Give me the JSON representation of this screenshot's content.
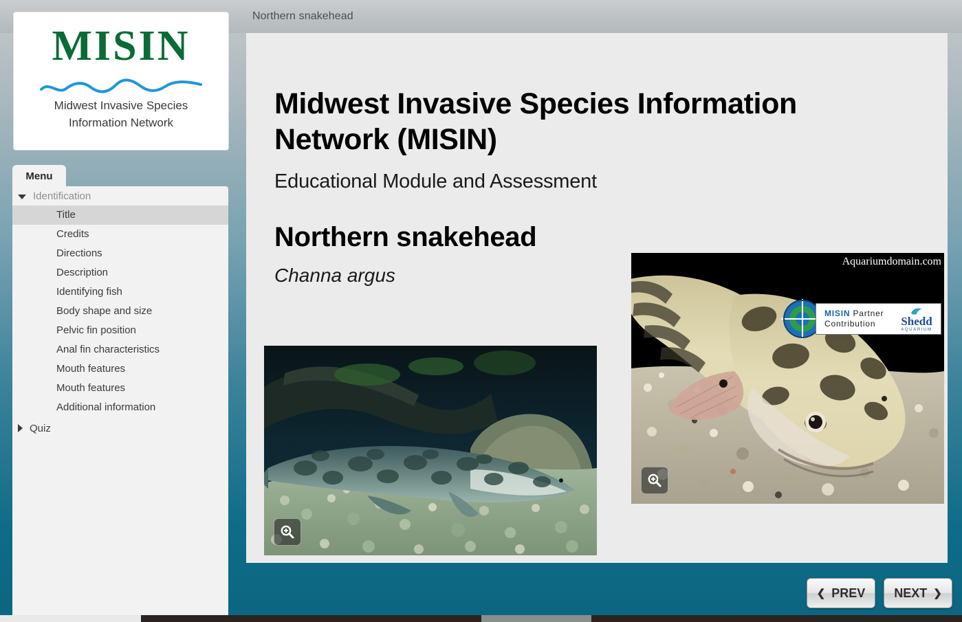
{
  "topbar": {
    "title": "Northern snakehead"
  },
  "logo": {
    "wordmark": "MISIN",
    "subtitle_line1": "Midwest Invasive Species",
    "subtitle_line2": "Information Network",
    "wave_color": "#2196d9",
    "wordmark_color": "#0a6b37"
  },
  "sidebar": {
    "tab_label": "Menu",
    "groups": [
      {
        "label": "Identification",
        "expanded": true,
        "icon": "chevron-down-icon",
        "items": [
          {
            "label": "Title",
            "selected": true
          },
          {
            "label": "Credits",
            "selected": false
          },
          {
            "label": "Directions",
            "selected": false
          },
          {
            "label": "Description",
            "selected": false
          },
          {
            "label": "Identifying fish",
            "selected": false
          },
          {
            "label": "Body shape and size",
            "selected": false
          },
          {
            "label": "Pelvic fin position",
            "selected": false
          },
          {
            "label": "Anal fin characteristics",
            "selected": false
          },
          {
            "label": "Mouth features",
            "selected": false
          },
          {
            "label": "Mouth features",
            "selected": false
          },
          {
            "label": "Additional information",
            "selected": false
          }
        ]
      },
      {
        "label": "Quiz",
        "expanded": false,
        "icon": "chevron-right-icon",
        "items": []
      }
    ]
  },
  "main": {
    "org_title": "Midwest Invasive Species Information Network (MISIN)",
    "subtitle": "Educational Module and Assessment",
    "species_common_name": "Northern snakehead",
    "species_scientific_name": "Channa argus",
    "photos": [
      {
        "name": "snakehead-full-body-photo",
        "caption": "",
        "zoom_icon": "magnify-plus-icon"
      },
      {
        "name": "snakehead-head-closeup-photo",
        "watermark": "Aquariumdomain.com",
        "zoom_icon": "magnify-plus-icon"
      }
    ]
  },
  "badge": {
    "line1_brand": "MISIN",
    "line1_rest": " Partner",
    "line2": "Contribution",
    "partner_name": "Shedd",
    "partner_sub": "AQUARIUM",
    "target_icon": "crosshair-target-icon"
  },
  "nav": {
    "prev_label": "PREV",
    "next_label": "NEXT",
    "prev_icon": "chevron-left-icon",
    "next_icon": "chevron-right-icon"
  },
  "colors": {
    "background_teal": "#0e6c88",
    "panel_gray": "#ebebeb",
    "menu_gray": "#f2f2f2",
    "selected_gray": "#d6d6d6",
    "topbar_gray": "#bcc1c4",
    "misin_green": "#0a6b37",
    "shedd_blue": "#1d4e8f"
  }
}
